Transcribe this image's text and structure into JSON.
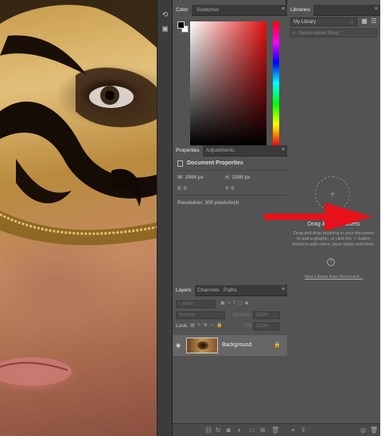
{
  "color_panel": {
    "tabs": [
      "Color",
      "Swatches"
    ],
    "menu_icon": "panel-menu-icon"
  },
  "properties_panel": {
    "tabs": [
      "Properties",
      "Adjustments"
    ],
    "title": "Document Properties",
    "width": "W: 2996 px",
    "height": "H: 1998 px",
    "x": "X: 0",
    "y": "Y: 0",
    "resolution": "Resolution: 300 pixels/inch"
  },
  "layers_panel": {
    "tabs": [
      "Layers",
      "Channels",
      "Paths"
    ],
    "filter_kind": "Kind",
    "blend_mode": "Normal",
    "opacity_label": "Opacity:",
    "opacity_value": "100%",
    "lock_label": "Lock:",
    "fill_label": "Fill:",
    "fill_value": "100%",
    "layer_name": "Background",
    "footer_icons": [
      "link-icon",
      "fx-icon",
      "mask-icon",
      "adjustment-icon",
      "folder-icon",
      "new-layer-icon",
      "trash-icon"
    ]
  },
  "libraries_panel": {
    "tab": "Libraries",
    "library_select": "My Library",
    "search_placeholder": "Search Adobe Stock",
    "drop_title": "Drag & Drop Assets",
    "drop_text": "Drag and drop anything in your document to add a graphic, or click the '+' button below to add colors, layer styles and more.",
    "help": "?",
    "new_library_link": "New Library from Document...",
    "footer_icons": [
      "add-icon",
      "cloud-upload-icon",
      "stock-icon",
      "trash-icon"
    ]
  },
  "colors": {
    "panel_bg": "#535353",
    "arrow": "#e8101a"
  }
}
